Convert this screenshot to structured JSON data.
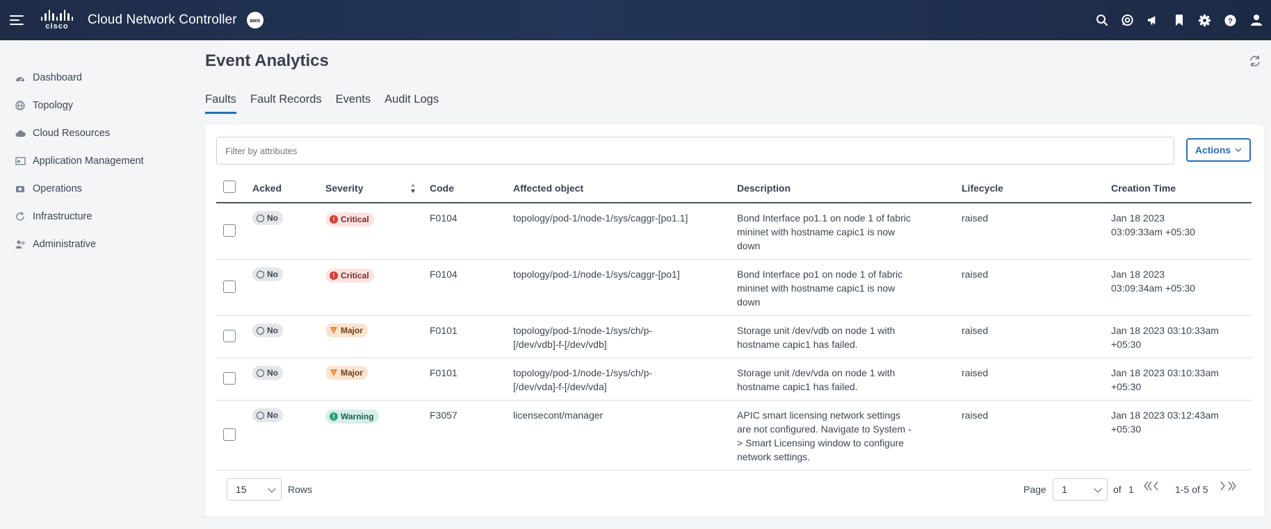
{
  "header": {
    "app_title": "Cloud Network Controller",
    "brand": "cisco",
    "cloud_badge": "aws"
  },
  "sidebar": {
    "items": [
      {
        "label": "Dashboard",
        "icon": "dashboard-icon"
      },
      {
        "label": "Topology",
        "icon": "globe-icon"
      },
      {
        "label": "Cloud Resources",
        "icon": "cloud-icon"
      },
      {
        "label": "Application Management",
        "icon": "app-window-icon"
      },
      {
        "label": "Operations",
        "icon": "camera-icon"
      },
      {
        "label": "Infrastructure",
        "icon": "sync-icon"
      },
      {
        "label": "Administrative",
        "icon": "admin-user-icon"
      }
    ]
  },
  "page": {
    "title": "Event Analytics",
    "tabs": [
      "Faults",
      "Fault Records",
      "Events",
      "Audit Logs"
    ],
    "active_tab": "Faults"
  },
  "filter": {
    "placeholder": "Filter by attributes"
  },
  "actions": {
    "label": "Actions"
  },
  "table": {
    "columns": [
      "Acked",
      "Severity",
      "Code",
      "Affected object",
      "Description",
      "Lifecycle",
      "Creation Time"
    ],
    "rows": [
      {
        "acked": "No",
        "severity": "Critical",
        "code": "F0104",
        "affected": "topology/pod-1/node-1/sys/caggr-[po1.1]",
        "description": [
          "Bond Interface po1.1 on node 1 of fabric",
          "mininet with hostname capic1 is now",
          "down"
        ],
        "lifecycle": "raised",
        "time": [
          "Jan 18 2023",
          "03:09:33am +05:30"
        ]
      },
      {
        "acked": "No",
        "severity": "Critical",
        "code": "F0104",
        "affected": "topology/pod-1/node-1/sys/caggr-[po1]",
        "description": [
          "Bond Interface po1 on node 1 of fabric",
          "mininet with hostname capic1 is now",
          "down"
        ],
        "lifecycle": "raised",
        "time": [
          "Jan 18 2023",
          "03:09:34am +05:30"
        ]
      },
      {
        "acked": "No",
        "severity": "Major",
        "code": "F0101",
        "affected": "topology/pod-1/node-1/sys/ch/p-\n[/dev/vdb]-f-[/dev/vdb]",
        "description": [
          "Storage unit /dev/vdb on node 1 with",
          "hostname capic1 has failed."
        ],
        "lifecycle": "raised",
        "time": [
          "Jan 18 2023 03:10:33am",
          "+05:30"
        ]
      },
      {
        "acked": "No",
        "severity": "Major",
        "code": "F0101",
        "affected": "topology/pod-1/node-1/sys/ch/p-\n[/dev/vda]-f-[/dev/vda]",
        "description": [
          "Storage unit /dev/vda on node 1 with",
          "hostname capic1 has failed."
        ],
        "lifecycle": "raised",
        "time": [
          "Jan 18 2023 03:10:33am",
          "+05:30"
        ]
      },
      {
        "acked": "No",
        "severity": "Warning",
        "code": "F3057",
        "affected": "licensecont/manager",
        "description": [
          "APIC smart licensing network settings",
          "are not configured. Navigate to System -",
          "> Smart Licensing window to configure",
          "network settings."
        ],
        "lifecycle": "raised",
        "time": [
          "Jan 18 2023 03:12:43am",
          "+05:30"
        ]
      }
    ]
  },
  "pagination": {
    "rows_per_page": "15",
    "rows_label": "Rows",
    "page_label": "Page",
    "page_value": "1",
    "of_label": "of",
    "total_pages": "1",
    "range": "1-5 of 5"
  },
  "colors": {
    "header_bg": "#1e2c48",
    "accent": "#2b6cb8",
    "critical": "#d43d35",
    "major": "#e8843a",
    "warning": "#2fa07e"
  }
}
